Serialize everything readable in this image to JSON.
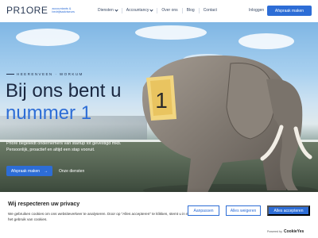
{
  "header": {
    "logo": "PR1ORE",
    "logo_sub": "accountants & bedrijfsadviseurs",
    "nav": [
      {
        "label": "Diensten",
        "dropdown": true
      },
      {
        "label": "Accountancy",
        "dropdown": true
      },
      {
        "label": "Over ons",
        "dropdown": false
      },
      {
        "label": "Blog",
        "dropdown": false
      },
      {
        "label": "Contact",
        "dropdown": false
      }
    ],
    "login": "Inloggen",
    "cta": "Afspraak maken"
  },
  "hero": {
    "eyebrow": "HEERENVEEN · WORKUM",
    "headline_line1": "Bij ons bent u",
    "headline_line2": "nummer 1",
    "sub_line1": "Priore begeleidt ondernemers van startup tot gevestigd mkb.",
    "sub_line2": "Persoonlijk, proactief en altijd een stap vooruit.",
    "primary_button": "Afspraak maken",
    "primary_arrow": "→",
    "secondary_button": "Onze diensten",
    "saddle_number": "1"
  },
  "cookie": {
    "title": "Wij respecteren uw privacy",
    "text": "We gebruiken cookies om ons websiteverkeer te analyseren. Door op \"Alles accepteren\" te klikken, stemt u in met het gebruik van cookies.",
    "customize": "Aanpassen",
    "reject": "Alles weigeren",
    "accept": "Alles accepteren",
    "powered_by": "Powered by",
    "brand": "CookieYes"
  },
  "colors": {
    "accent": "#2d6dd6",
    "navy": "#1a2740"
  }
}
